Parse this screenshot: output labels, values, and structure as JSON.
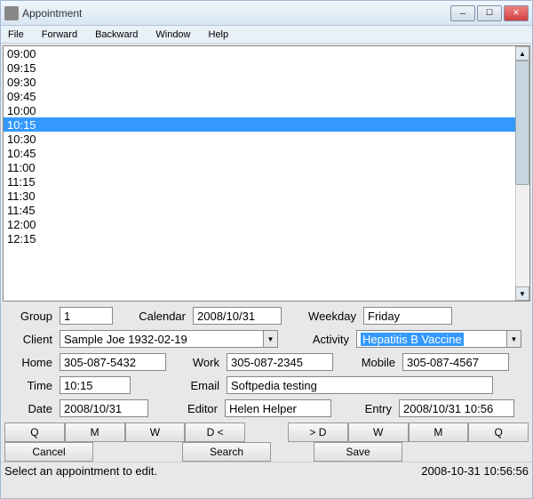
{
  "window": {
    "title": "Appointment"
  },
  "menu": {
    "file": "File",
    "forward": "Forward",
    "backward": "Backward",
    "window": "Window",
    "help": "Help"
  },
  "timeSlots": [
    {
      "label": "09:00",
      "selected": false
    },
    {
      "label": "09:15",
      "selected": false
    },
    {
      "label": "09:30",
      "selected": false
    },
    {
      "label": "09:45",
      "selected": false
    },
    {
      "label": "10:00",
      "selected": false
    },
    {
      "label": "10:15",
      "selected": true
    },
    {
      "label": "10:30",
      "selected": false
    },
    {
      "label": "10:45",
      "selected": false
    },
    {
      "label": "11:00",
      "selected": false
    },
    {
      "label": "11:15",
      "selected": false
    },
    {
      "label": "11:30",
      "selected": false
    },
    {
      "label": "11:45",
      "selected": false
    },
    {
      "label": "12:00",
      "selected": false
    },
    {
      "label": "12:15",
      "selected": false
    }
  ],
  "form": {
    "labels": {
      "group": "Group",
      "calendar": "Calendar",
      "weekday": "Weekday",
      "client": "Client",
      "activity": "Activity",
      "home": "Home",
      "work": "Work",
      "mobile": "Mobile",
      "time": "Time",
      "email": "Email",
      "date": "Date",
      "editor": "Editor",
      "entry": "Entry"
    },
    "values": {
      "group": "1",
      "calendar": "2008/10/31",
      "weekday": "Friday",
      "client": "Sample Joe 1932-02-19",
      "activity": "Hepatitis B Vaccine",
      "home": "305-087-5432",
      "work": "305-087-2345",
      "mobile": "305-087-4567",
      "time": "10:15",
      "email": "Softpedia testing",
      "date": "2008/10/31",
      "editor": "Helen Helper",
      "entry": "2008/10/31 10:56"
    }
  },
  "navButtons": {
    "q1": "Q",
    "m1": "M",
    "w1": "W",
    "dprev": "D  <",
    "dnext": ">  D",
    "w2": "W",
    "m2": "M",
    "q2": "Q"
  },
  "actionButtons": {
    "cancel": "Cancel",
    "search": "Search",
    "save": "Save"
  },
  "status": {
    "message": "Select an appointment to edit.",
    "timestamp": "2008-10-31 10:56:56"
  }
}
